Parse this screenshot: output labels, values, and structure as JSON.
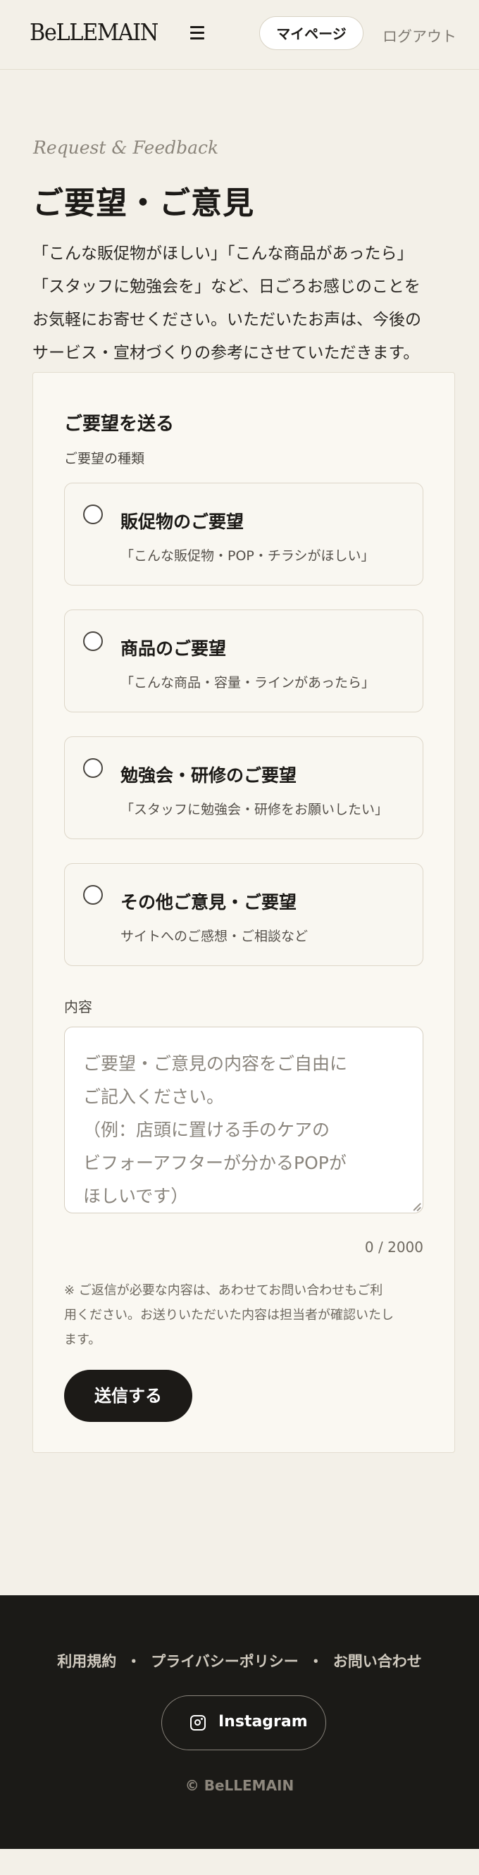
{
  "header": {
    "logo": "BeLLEMAIN",
    "mypage_label": "マイページ",
    "logout_label": "ログアウト"
  },
  "hero": {
    "eyebrow": "Request & Feedback",
    "title": "ご要望・ご意見",
    "intro_lines": [
      "「こんな販促物がほしい」「こんな商品があったら」",
      "「スタッフに勉強会を」など、日ごろお感じのことを",
      "お気軽にお寄せください。いただいたお声は、今後の",
      "サービス・宣材づくりの参考にさせていただきます。"
    ]
  },
  "form": {
    "title": "ご要望を送る",
    "type_label": "ご要望の種類",
    "options": [
      {
        "title": "販促物のご要望",
        "desc": "「こんな販促物・POP・チラシがほしい」"
      },
      {
        "title": "商品のご要望",
        "desc": "「こんな商品・容量・ラインがあったら」"
      },
      {
        "title": "勉強会・研修のご要望",
        "desc": "「スタッフに勉強会・研修をお願いしたい」"
      },
      {
        "title": "その他ご意見・ご要望",
        "desc": "サイトへのご感想・ご相談など"
      }
    ],
    "content_label": "内容",
    "placeholder": "ご要望・ご意見の内容をご自由に\nご記入ください。\n（例：店頭に置ける手のケアの\nビフォーアフターが分かるPOPが\nほしいです）",
    "counter": "0 / 2000",
    "note": "※ ご返信が必要な内容は、あわせてお問い合わせもご利用ください。お送りいただいた内容は担当者が確認いたします。",
    "submit_label": "送信する"
  },
  "footer": {
    "links": [
      "利用規約",
      "プライバシーポリシー",
      "お問い合わせ"
    ],
    "separator": "・",
    "instagram_label": "Instagram",
    "copyright": "© BeLLEMAIN"
  },
  "colors": {
    "background": "#f3f0e8",
    "card": "#faf8f2",
    "primary": "#1c1a17",
    "footer": "#1b1a17"
  },
  "icons": {
    "menu": "hamburger-menu-icon",
    "radio": "radio-unchecked-icon",
    "instagram": "instagram-icon"
  }
}
